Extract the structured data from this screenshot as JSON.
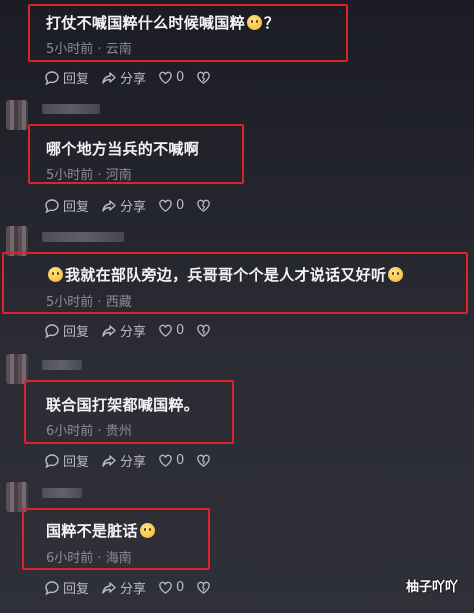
{
  "comments": [
    {
      "text": "打仗不喊国粹什么时候喊国粹",
      "suffix": "？",
      "time": "5小时前",
      "location": "云南",
      "lead_emoji": false,
      "trail_emoji": true
    },
    {
      "text": "哪个地方当兵的不喊啊",
      "suffix": "",
      "time": "5小时前",
      "location": "河南",
      "lead_emoji": false,
      "trail_emoji": false
    },
    {
      "text": "我就在部队旁边，兵哥哥个个是人才说话又好听",
      "suffix": "",
      "time": "5小时前",
      "location": "西藏",
      "lead_emoji": true,
      "trail_emoji": true
    },
    {
      "text": "联合国打架都喊国粹。",
      "suffix": "",
      "time": "6小时前",
      "location": "贵州",
      "lead_emoji": false,
      "trail_emoji": false
    },
    {
      "text": "国粹不是脏话",
      "suffix": "",
      "time": "6小时前",
      "location": "海南",
      "lead_emoji": false,
      "trail_emoji": true
    }
  ],
  "actions": {
    "reply": "回复",
    "share": "分享",
    "like_count": "0"
  },
  "separator": " · ",
  "watermark": "柚子吖吖",
  "colors": {
    "highlight": "#e0202a",
    "text": "#f4f4f6",
    "meta": "#8a8b94"
  },
  "icons": [
    "comment-icon",
    "share-icon",
    "heart-icon",
    "dislike-icon"
  ]
}
